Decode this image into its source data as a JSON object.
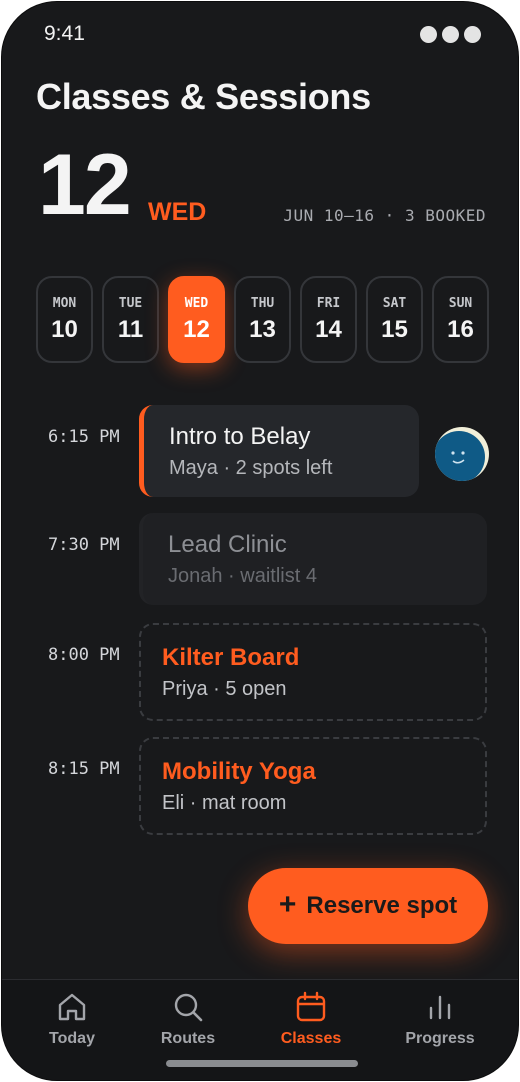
{
  "status": {
    "time": "9:41"
  },
  "header": {
    "title": "Classes & Sessions",
    "day_number": "12",
    "weekday": "WED",
    "range": "JUN 10–16 · 3 BOOKED"
  },
  "days": [
    {
      "dow": "MON",
      "num": "10",
      "selected": false
    },
    {
      "dow": "TUE",
      "num": "11",
      "selected": false
    },
    {
      "dow": "WED",
      "num": "12",
      "selected": true
    },
    {
      "dow": "THU",
      "num": "13",
      "selected": false
    },
    {
      "dow": "FRI",
      "num": "14",
      "selected": false
    },
    {
      "dow": "SAT",
      "num": "15",
      "selected": false
    },
    {
      "dow": "SUN",
      "num": "16",
      "selected": false
    }
  ],
  "sessions": [
    {
      "time": "6:15 PM",
      "title": "Intro to Belay",
      "subtitle": "Maya · 2 spots left",
      "state": "booked"
    },
    {
      "time": "7:30 PM",
      "title": "Lead Clinic",
      "subtitle": "Jonah · waitlist 4",
      "state": "waitlist"
    },
    {
      "time": "8:00 PM",
      "title": "Kilter Board",
      "subtitle": "Priya · 5 open",
      "state": "open"
    },
    {
      "time": "8:15 PM",
      "title": "Mobility Yoga",
      "subtitle": "Eli · mat room",
      "state": "open"
    }
  ],
  "fab": {
    "icon": "plus",
    "label": "Reserve spot"
  },
  "tabs": [
    {
      "label": "Today",
      "icon": "home-icon",
      "active": false
    },
    {
      "label": "Routes",
      "icon": "search-icon",
      "active": false
    },
    {
      "label": "Classes",
      "icon": "calendar-icon",
      "active": true
    },
    {
      "label": "Progress",
      "icon": "bar-chart-icon",
      "active": false
    }
  ],
  "colors": {
    "accent": "#ff5c1f",
    "background": "#18191b",
    "card": "#25272b",
    "text": "#f4f4f4",
    "muted": "#a3a5aa"
  }
}
